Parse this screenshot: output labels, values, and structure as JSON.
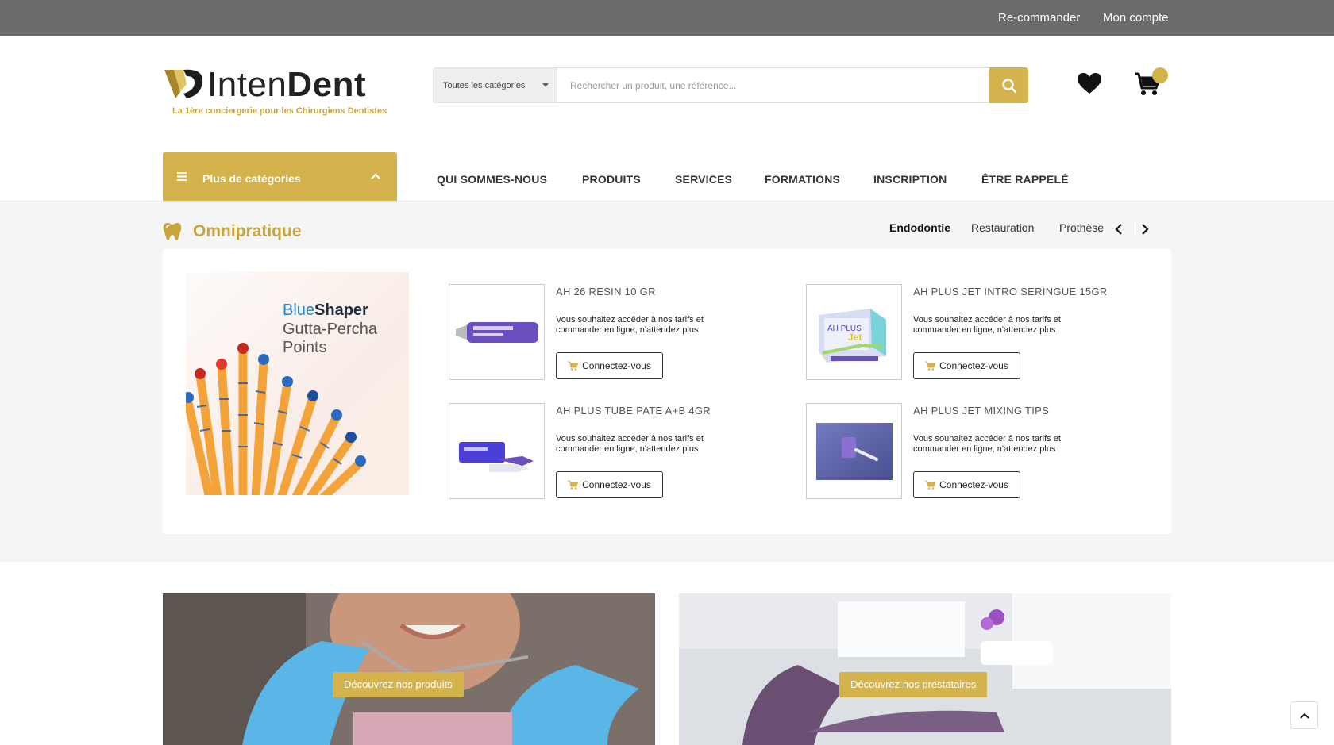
{
  "topbar": {
    "reorder": "Re-commander",
    "account": "Mon compte"
  },
  "brand": {
    "name_light": "Inten",
    "name_bold": "Dent",
    "tagline": "La 1ère conciergerie pour les Chirurgiens Dentistes",
    "accent_color": "#d4b24c"
  },
  "search": {
    "category": "Toutes les catégories",
    "placeholder": "Rechercher un produit, une référence...",
    "button_icon": "search-icon"
  },
  "header_icons": {
    "wishlist": "heart-icon",
    "cart": "cart-icon"
  },
  "category_menu": {
    "label": "Plus de catégories"
  },
  "nav": [
    "QUI SOMMES-NOUS",
    "PRODUITS",
    "SERVICES",
    "FORMATIONS",
    "INSCRIPTION",
    "ÊTRE RAPPELÉ"
  ],
  "section": {
    "title": "Omnipratique",
    "tabs": [
      "Endodontie",
      "Restauration",
      "Prothèse"
    ],
    "active_tab": "Endodontie"
  },
  "promo": {
    "brand_light": "Blue",
    "brand_bold": "Shaper",
    "line2": "Gutta-Percha",
    "line3": "Points"
  },
  "products": [
    {
      "name": "AH 26 RESIN 10 GR",
      "desc": "Vous souhaitez accéder à nos tarifs et commander en ligne, n'attendez plus",
      "button": "Connectez-vous"
    },
    {
      "name": "AH PLUS JET INTRO SERINGUE 15GR",
      "desc": "Vous souhaitez accéder à nos tarifs et commander en ligne, n'attendez plus",
      "button": "Connectez-vous"
    },
    {
      "name": "AH PLUS TUBE PATE A+B 4GR",
      "desc": "Vous souhaitez accéder à nos tarifs et commander en ligne, n'attendez plus",
      "button": "Connectez-vous"
    },
    {
      "name": "AH PLUS JET MIXING TIPS",
      "desc": "Vous souhaitez accéder à nos tarifs et commander en ligne, n'attendez plus",
      "button": "Connectez-vous"
    }
  ],
  "banners": [
    {
      "cta": "Découvrez nos produits"
    },
    {
      "cta": "Découvrez nos prestataires"
    }
  ]
}
